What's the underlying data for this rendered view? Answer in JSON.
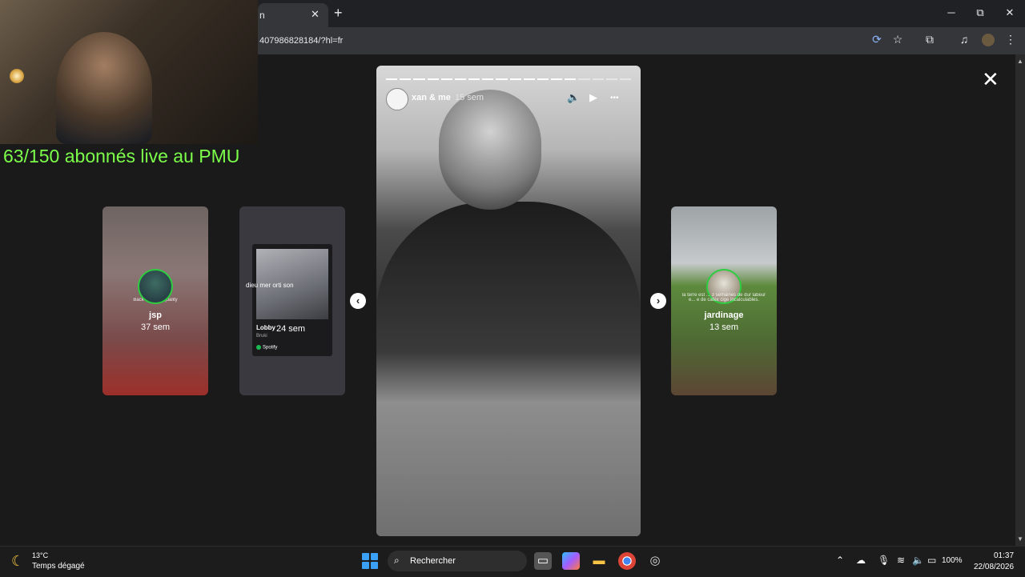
{
  "browser": {
    "tab_title": "n",
    "tab_close": "✕",
    "new_tab": "+",
    "url": "407986828184/?hl=fr",
    "window_controls": {
      "minimize": "─",
      "restore": "⧉",
      "close": "✕"
    },
    "toolbar_icons": [
      "sync-icon",
      "star-icon",
      "extensions-icon",
      "media-icon",
      "profile-avatar",
      "menu-icon"
    ]
  },
  "viewer": {
    "close_label": "✕",
    "prev_arrow": "‹",
    "next_arrow": "›",
    "main_story": {
      "user": "xan & me",
      "age": "15 sem",
      "progress_segments_total": 18,
      "progress_segments_done": 14,
      "controls": {
        "mute": "🔈",
        "play": "▶",
        "more": "•••"
      }
    },
    "side_stories": [
      {
        "name": "jsp",
        "time": "37 sem",
        "overlay_text": "Back stage ... quality"
      },
      {
        "caption": "dieu mer        orti son",
        "track": "Lobby",
        "artist": "Bruki",
        "time": "24 sem",
        "platform": "Spotify"
      },
      {
        "name": "jardinage",
        "time": "13 sem",
        "overlay_text": "la terre est ... 3 semaines de dur labeur e... e de caféx cige incalculables."
      }
    ]
  },
  "stream_overlay": {
    "text": "63/150 abonnés live au PMU",
    "color": "#7cff4a"
  },
  "taskbar": {
    "weather_temp": "13°C",
    "weather_desc": "Temps dégagé",
    "search_placeholder": "Rechercher",
    "battery": "100%",
    "time": "01:37",
    "date": "22/08/2026"
  }
}
